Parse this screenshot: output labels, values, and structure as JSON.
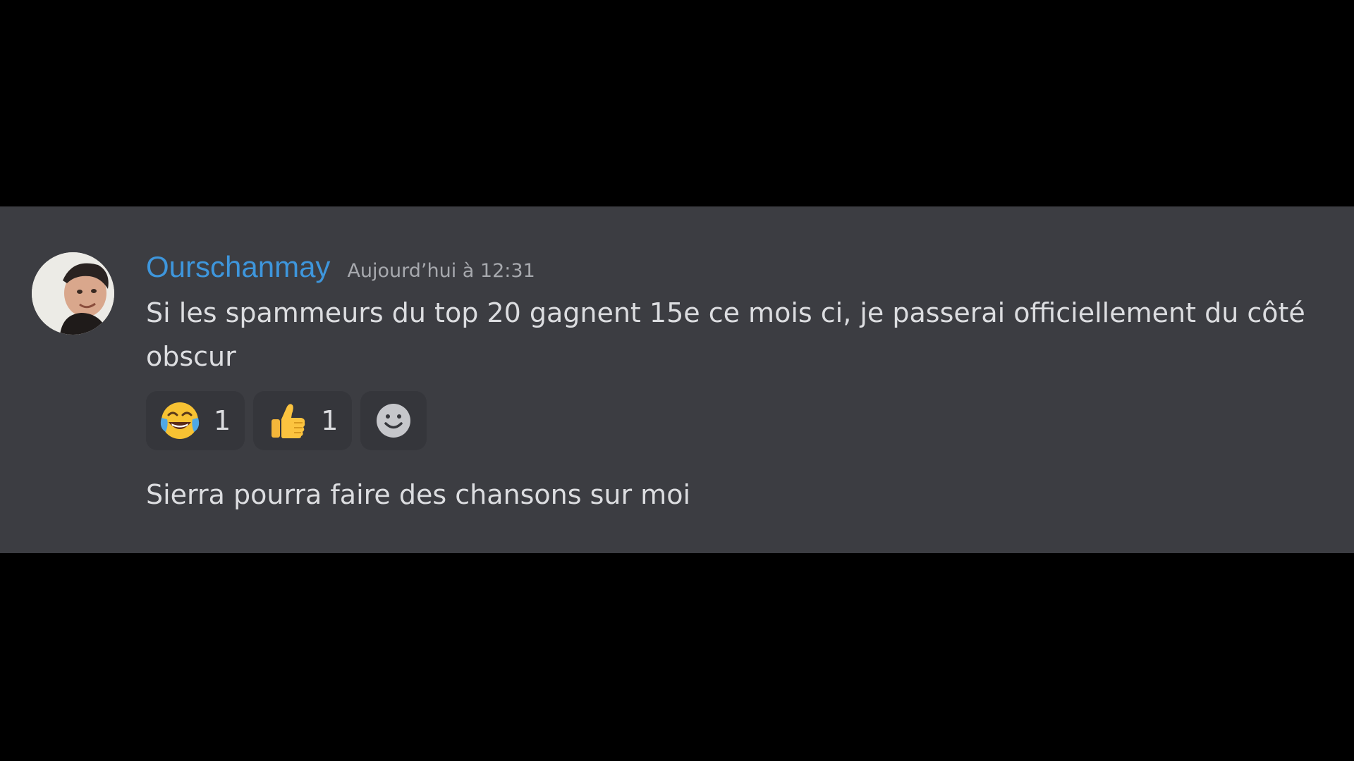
{
  "message": {
    "author": "Ourschanmay",
    "timestamp": "Aujourd’hui à 12:31",
    "text": "Si les spammeurs du top 20 gagnent 15e ce mois ci, je passerai officiellement du côté obscur",
    "reactions": [
      {
        "icon": "laughing-tears-emoji-icon",
        "count": "1"
      },
      {
        "icon": "thumbs-up-emoji-icon",
        "count": "1"
      }
    ],
    "add_reaction_icon": "add-reaction-smiley-icon",
    "followup_text": "Sierra pourra faire des chansons sur moi"
  },
  "colors": {
    "background": "#000000",
    "panel": "#3c3d42",
    "username": "#3e96dc",
    "timestamp": "#a7a9ae",
    "text": "#dcdde0",
    "reaction_bg": "#35363b"
  }
}
